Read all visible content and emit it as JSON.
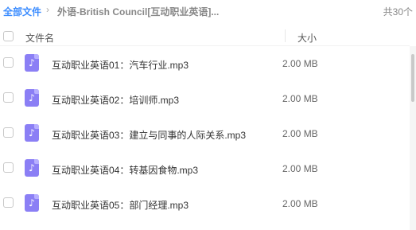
{
  "breadcrumb": {
    "root": "全部文件",
    "separator": "›",
    "current": "外语-British Council[互动职业英语]..."
  },
  "total_count": "共30个",
  "columns": {
    "name": "文件名",
    "size": "大小"
  },
  "files": [
    {
      "name": "互动职业英语01：汽车行业.mp3",
      "size": "2.00 MB",
      "icon": "audio-file-icon"
    },
    {
      "name": "互动职业英语02：培训师.mp3",
      "size": "2.00 MB",
      "icon": "audio-file-icon"
    },
    {
      "name": "互动职业英语03：建立与同事的人际关系.mp3",
      "size": "2.00 MB",
      "icon": "audio-file-icon"
    },
    {
      "name": "互动职业英语04：转基因食物.mp3",
      "size": "2.00 MB",
      "icon": "audio-file-icon"
    },
    {
      "name": "互动职业英语05：部门经理.mp3",
      "size": "2.00 MB",
      "icon": "audio-file-icon"
    }
  ],
  "colors": {
    "accent": "#3b8cff",
    "audio_icon": "#8b7ff5"
  }
}
